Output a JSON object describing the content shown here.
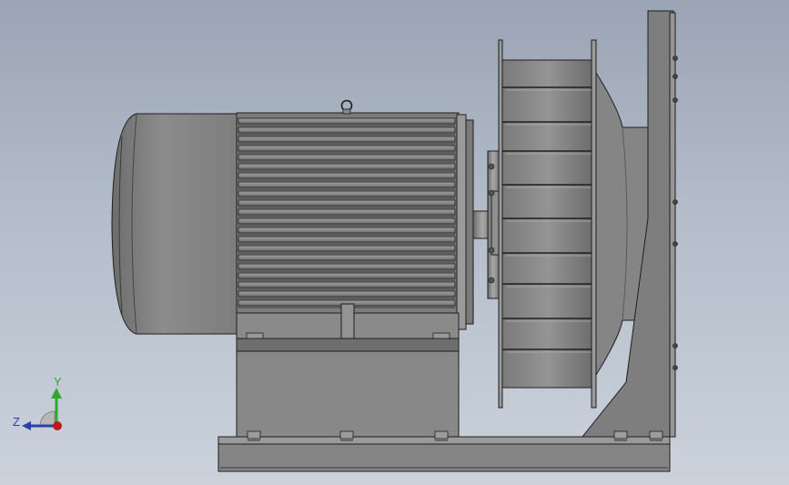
{
  "viewport": {
    "background_top": "#9aa4b4",
    "background_bottom": "#cbd2dc"
  },
  "model": {
    "body_color": "#8a8a8a",
    "edge_color": "#1e1e1e"
  },
  "triad": {
    "y_label": "Y",
    "z_label": "Z",
    "y_color": "#2faa2f",
    "z_color": "#2a3fa8",
    "x_color": "#c01818"
  }
}
